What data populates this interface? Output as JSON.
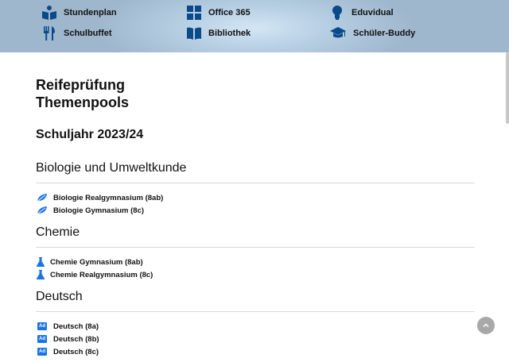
{
  "nav": {
    "items": [
      {
        "label": "Stundenplan",
        "icon": "book-reader-icon"
      },
      {
        "label": "Office 365",
        "icon": "windows-icon"
      },
      {
        "label": "Eduvidual",
        "icon": "lightbulb-icon"
      },
      {
        "label": "Schulbuffet",
        "icon": "utensils-icon"
      },
      {
        "label": "Bibliothek",
        "icon": "open-book-icon"
      },
      {
        "label": "Schüler-Buddy",
        "icon": "graduation-cap-icon"
      }
    ]
  },
  "page": {
    "title_line1": "Reifeprüfung",
    "title_line2": "Themenpools",
    "subtitle": "Schuljahr 2023/24"
  },
  "sections": [
    {
      "title": "Biologie und Umweltkunde",
      "icon": "leaf-icon",
      "links": [
        "Biologie Realgymnasium (8ab)",
        "Biologie Gymnasium (8c)"
      ]
    },
    {
      "title": "Chemie",
      "icon": "flask-icon",
      "links": [
        "Chemie Gymnasium (8ab)",
        "Chemie Realgymnasium (8c)"
      ]
    },
    {
      "title": "Deutsch",
      "icon": "adobe-badge-icon",
      "badge_text": "Ad",
      "links": [
        "Deutsch (8a)",
        "Deutsch (8b)",
        "Deutsch (8c)"
      ]
    }
  ],
  "colors": {
    "accent": "#1a73e8",
    "nav_icon": "#0b4a8a",
    "divider": "#d9d9d9"
  }
}
